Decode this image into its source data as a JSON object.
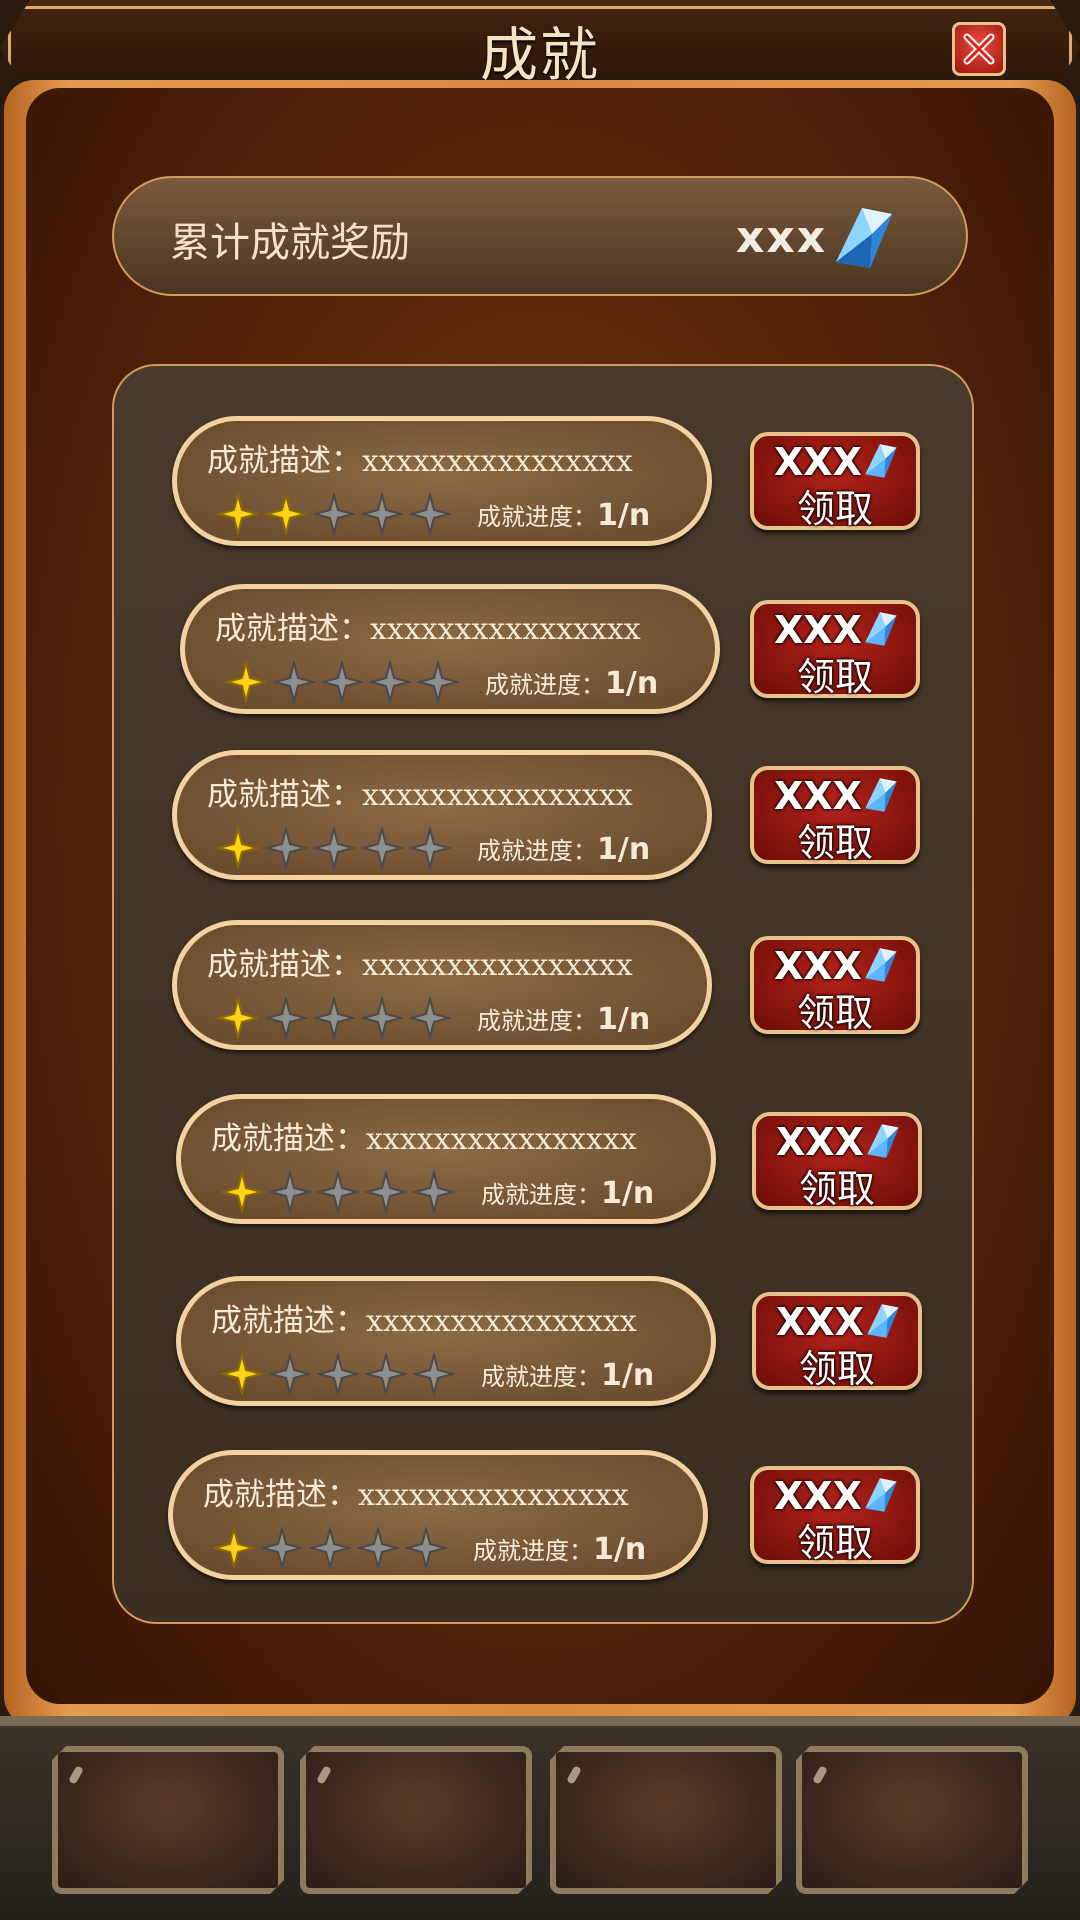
{
  "header": {
    "title": "成就",
    "close_icon": "close-x-icon"
  },
  "total_reward": {
    "label": "累计成就奖励",
    "value": "xxx",
    "icon": "diamond-icon"
  },
  "achievements": [
    {
      "desc_label": "成就描述：",
      "desc_value": "xxxxxxxxxxxxxxxx",
      "progress_label": "成就进度：",
      "progress_value": "1/n",
      "stars_filled": 2,
      "stars_total": 5,
      "reward": "XXX",
      "claim_label": "领取"
    },
    {
      "desc_label": "成就描述：",
      "desc_value": "xxxxxxxxxxxxxxxx",
      "progress_label": "成就进度：",
      "progress_value": "1/n",
      "stars_filled": 1,
      "stars_total": 5,
      "reward": "XXX",
      "claim_label": "领取"
    },
    {
      "desc_label": "成就描述：",
      "desc_value": "xxxxxxxxxxxxxxxx",
      "progress_label": "成就进度：",
      "progress_value": "1/n",
      "stars_filled": 1,
      "stars_total": 5,
      "reward": "XXX",
      "claim_label": "领取"
    },
    {
      "desc_label": "成就描述：",
      "desc_value": "xxxxxxxxxxxxxxxx",
      "progress_label": "成就进度：",
      "progress_value": "1/n",
      "stars_filled": 1,
      "stars_total": 5,
      "reward": "XXX",
      "claim_label": "领取"
    },
    {
      "desc_label": "成就描述：",
      "desc_value": "xxxxxxxxxxxxxxxx",
      "progress_label": "成就进度：",
      "progress_value": "1/n",
      "stars_filled": 1,
      "stars_total": 5,
      "reward": "XXX",
      "claim_label": "领取"
    },
    {
      "desc_label": "成就描述：",
      "desc_value": "xxxxxxxxxxxxxxxx",
      "progress_label": "成就进度：",
      "progress_value": "1/n",
      "stars_filled": 1,
      "stars_total": 5,
      "reward": "XXX",
      "claim_label": "领取"
    },
    {
      "desc_label": "成就描述：",
      "desc_value": "xxxxxxxxxxxxxxxx",
      "progress_label": "成就进度：",
      "progress_value": "1/n",
      "stars_filled": 1,
      "stars_total": 5,
      "reward": "XXX",
      "claim_label": "领取"
    }
  ],
  "bottom_bar": {
    "slots": 4
  },
  "colors": {
    "star_filled": "#ffd21a",
    "star_empty": "#8f8f8f",
    "claim_button": "#9c1a12",
    "accent_border": "#f3d1a0"
  }
}
